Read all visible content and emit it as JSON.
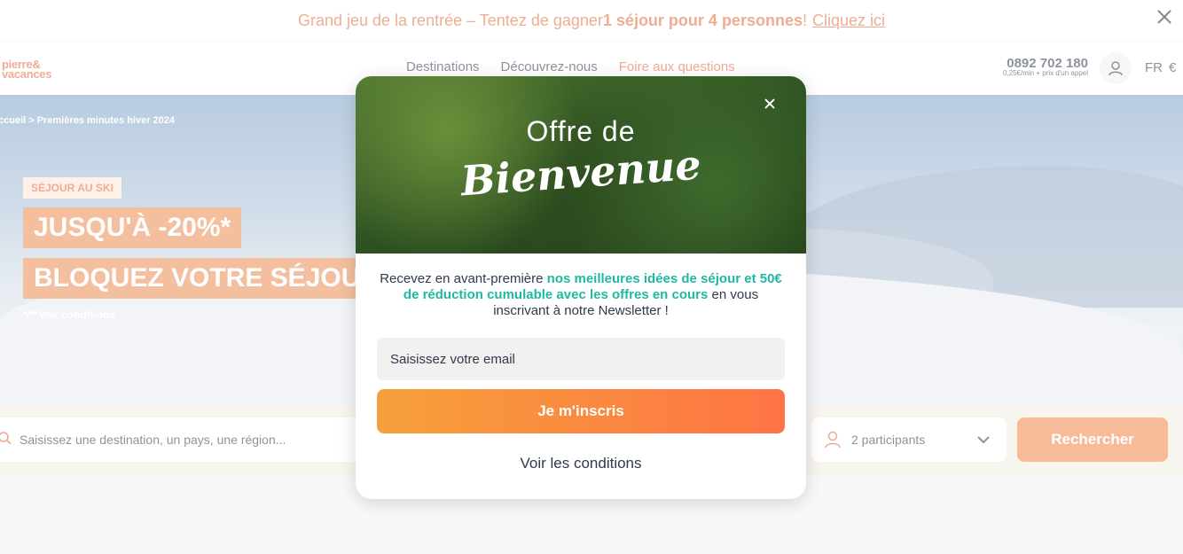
{
  "banner": {
    "text_prefix": "Grand jeu de la rentrée – Tentez de gagner ",
    "text_bold": "1 séjour pour 4 personnes",
    "text_suffix": " !",
    "link": "Cliquez ici"
  },
  "header": {
    "logo_line1": "pierre&",
    "logo_line2": "vacances",
    "nav": [
      "Destinations",
      "Découvrez-nous",
      "Foire aux questions"
    ],
    "phone": "0892 702 180",
    "phone_price": "0,25€/min + prix d'un appel",
    "lang": "FR",
    "currency": "€"
  },
  "hero": {
    "breadcrumb": "ccueil > Premières minutes hiver 2024",
    "tag": "SÉJOUR AU SKI",
    "promo1": "JUSQU'À -20%*",
    "promo2": "BLOQUEZ VOTRE SÉJOUR",
    "conditions": "*/**Voir conditions"
  },
  "search": {
    "placeholder": "Saisissez une destination, un pays, une région...",
    "participants": "2 participants",
    "button": "Rechercher"
  },
  "modal": {
    "title": "Offre de",
    "script": "Bienvenue",
    "text_prefix": "Recevez en avant-première ",
    "text_highlight": "nos meilleures idées de séjour et 50€ de réduction cumulable avec les offres en cours",
    "text_suffix": " en vous inscrivant à notre Newsletter !",
    "email_placeholder": "Saisissez votre email",
    "subscribe_button": "Je m'inscris",
    "conditions_link": "Voir les conditions"
  },
  "colors": {
    "brand_orange": "#e06a3a",
    "highlight_teal": "#1fb9a3"
  }
}
